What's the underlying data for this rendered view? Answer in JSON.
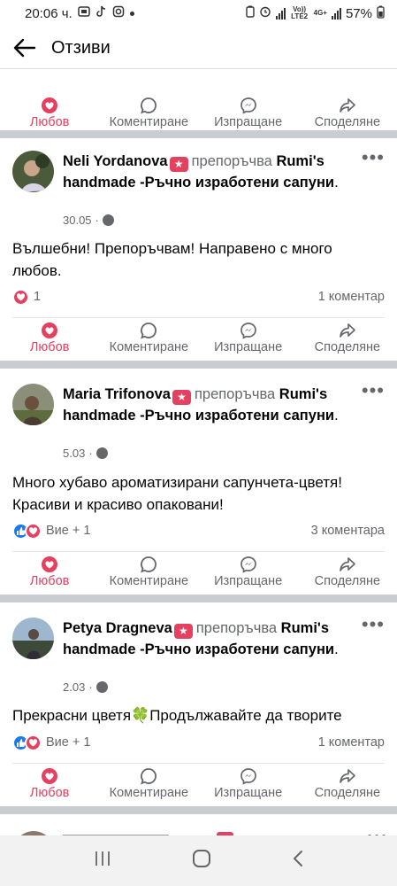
{
  "status": {
    "time": "20:06 ч.",
    "net": "Vo)) LTE2",
    "net2": "4G+",
    "battery": "57%"
  },
  "header": {
    "title": "Отзиви"
  },
  "actions": {
    "like": "Любов",
    "comment": "Коментиране",
    "send": "Изпращане",
    "share": "Споделяне"
  },
  "common": {
    "recommends": "препоръчва",
    "page_name": "Rumi's handmade -Ръчно изработени сапуни"
  },
  "posts": [
    {
      "author": "Neli Yordanova",
      "date": "30.05",
      "text": "Вълшебни! Препоръчвам! Направено с много любов.",
      "reactions": "1",
      "comments": "1 коментар"
    },
    {
      "author": "Maria Trifonova",
      "date": "5.03",
      "text": "Много хубаво ароматизирани сапунчета-цветя! Красиви и красиво опаковани!",
      "reactions": "Вие + 1",
      "comments": "3 коментара"
    },
    {
      "author": "Petya Dragneva",
      "date": "2.03",
      "text": "Прекрасни цветя🍀Продължавайте да творите",
      "reactions": "Вие + 1",
      "comments": "1 коментар"
    }
  ],
  "colors": {
    "love": "#e4405f",
    "like": "#1877f2",
    "muted": "#65676b",
    "separator": "#c9ccd1"
  }
}
